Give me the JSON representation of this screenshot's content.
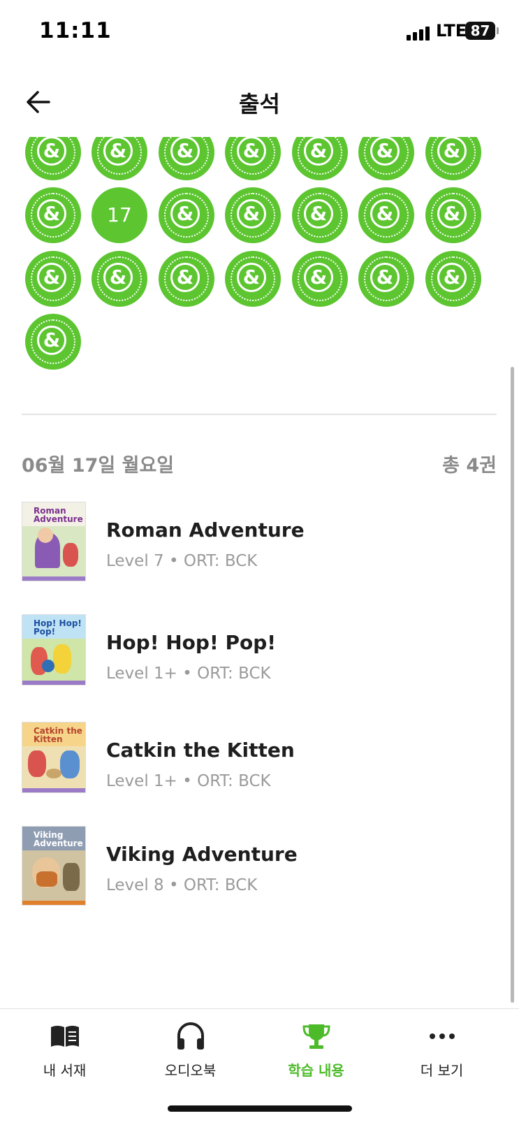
{
  "status_bar": {
    "time": "11:11",
    "network": "LTE",
    "battery": "87"
  },
  "header": {
    "title": "출석"
  },
  "attendance": {
    "highlight_day": "17",
    "badge_symbol": "&"
  },
  "summary": {
    "date": "06월 17일 월요일",
    "count": "총 4권"
  },
  "books": [
    {
      "title": "Roman Adventure",
      "meta": "Level 7 • ORT: BCK",
      "cover_text": "Roman Adventure"
    },
    {
      "title": "Hop! Hop! Pop!",
      "meta": "Level 1+ • ORT: BCK",
      "cover_text": "Hop! Hop! Pop!"
    },
    {
      "title": "Catkin the Kitten",
      "meta": "Level 1+ • ORT: BCK",
      "cover_text": "Catkin the Kitten"
    },
    {
      "title": "Viking Adventure",
      "meta": "Level 8 • ORT: BCK",
      "cover_text": "Viking Adventure"
    }
  ],
  "tabs": [
    {
      "label": "내 서재",
      "icon": "book-icon"
    },
    {
      "label": "오디오북",
      "icon": "headphones-icon"
    },
    {
      "label": "학습 내용",
      "icon": "trophy-icon",
      "active": true
    },
    {
      "label": "더 보기",
      "icon": "more-icon"
    }
  ],
  "colors": {
    "accent": "#5cc530",
    "active_tab": "#4dbb29",
    "muted_text": "#9a9a9a"
  }
}
